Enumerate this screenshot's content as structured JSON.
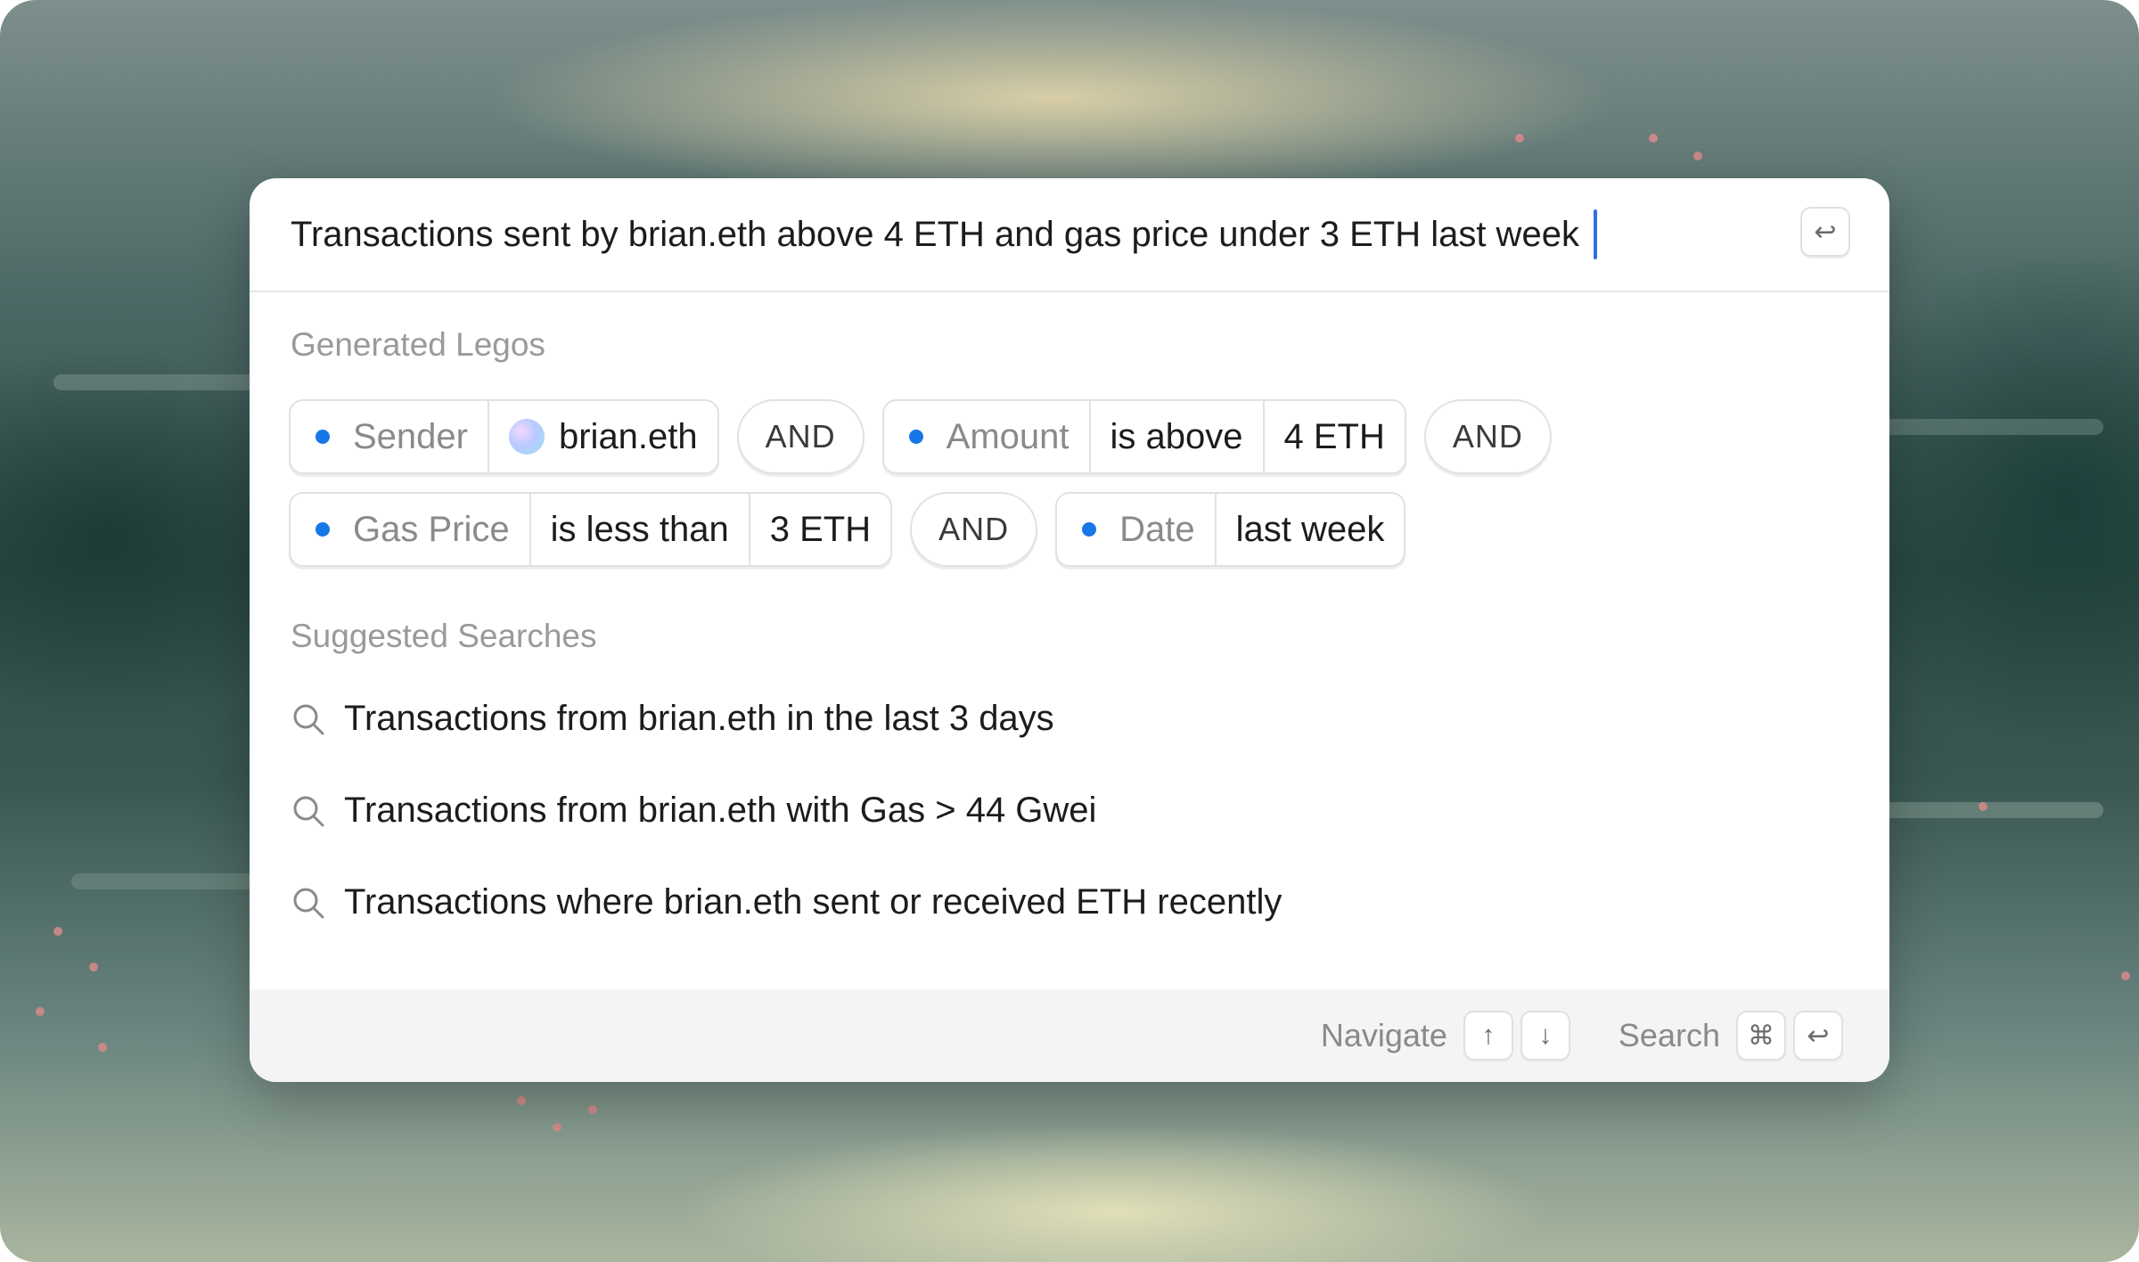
{
  "query": {
    "text": "Transactions sent by brian.eth above 4 ETH and gas price under 3 ETH last week",
    "submit_icon": "enter-icon"
  },
  "legos": {
    "section_label": "Generated Legos",
    "row1": {
      "sender_field": "Sender",
      "sender_value": "brian.eth",
      "and1": "AND",
      "amount_field": "Amount",
      "amount_op": "is above",
      "amount_value": "4 ETH",
      "and2": "AND"
    },
    "row2": {
      "gas_field": "Gas Price",
      "gas_op": "is less than",
      "gas_value": "3 ETH",
      "and3": "AND",
      "date_field": "Date",
      "date_value": "last week"
    },
    "bullet_color": "#1877e6"
  },
  "suggested": {
    "section_label": "Suggested Searches",
    "items": [
      "Transactions from brian.eth in the last 3 days",
      "Transactions from brian.eth with Gas > 44 Gwei",
      "Transactions where brian.eth sent or received ETH recently"
    ]
  },
  "footer": {
    "navigate_label": "Navigate",
    "search_label": "Search",
    "up_key": "↑",
    "down_key": "↓",
    "cmd_key": "⌘",
    "enter_key": "↩"
  }
}
